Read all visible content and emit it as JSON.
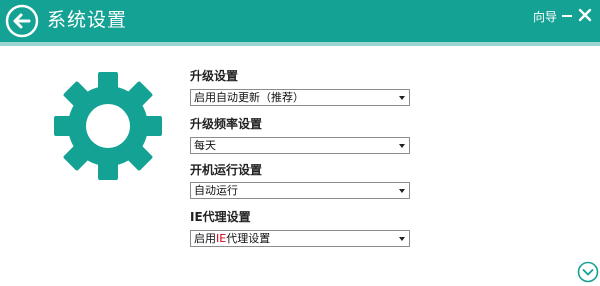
{
  "window": {
    "title": "系统设置",
    "wizard_label": "向导",
    "accent_color": "#14a295"
  },
  "icons": {
    "back": "back-arrow-circle-icon",
    "minimize": "minimize-icon",
    "close": "close-icon",
    "gear": "gear-icon",
    "scroll_down": "chevron-down-circle-icon"
  },
  "settings": {
    "upgrade": {
      "label": "升级设置",
      "value": "启用自动更新（推荐）"
    },
    "frequency": {
      "label": "升级频率设置",
      "value": "每天"
    },
    "startup": {
      "label": "开机运行设置",
      "value": "自动运行"
    },
    "ie_proxy": {
      "label": "IE代理设置",
      "value_prefix": "启用",
      "value_ie": "IE",
      "value_suffix": "代理设置"
    }
  }
}
